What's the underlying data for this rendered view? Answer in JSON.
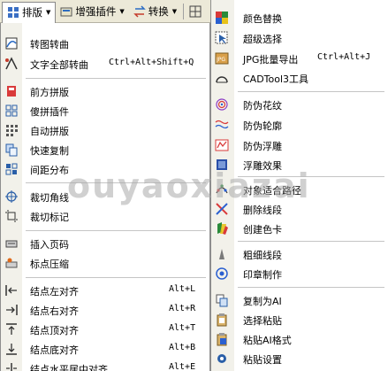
{
  "menubar": {
    "tabs": [
      {
        "label": "排版",
        "icon": "layout-icon"
      },
      {
        "label": "增强插件",
        "icon": "plugin-icon"
      },
      {
        "label": "转换",
        "icon": "convert-icon"
      }
    ]
  },
  "left_menu": {
    "items": [
      {
        "label": "转图转曲",
        "shortcut": ""
      },
      {
        "label": "文字全部转曲",
        "shortcut": "Ctrl+Alt+Shift+Q"
      },
      {
        "label": "前方拼版",
        "shortcut": ""
      },
      {
        "label": "傻拼插件",
        "shortcut": ""
      },
      {
        "label": "自动拼版",
        "shortcut": ""
      },
      {
        "label": "快速复制",
        "shortcut": ""
      },
      {
        "label": "间距分布",
        "shortcut": ""
      },
      {
        "label": "裁切角线",
        "shortcut": ""
      },
      {
        "label": "裁切标记",
        "shortcut": ""
      },
      {
        "label": "插入页码",
        "shortcut": ""
      },
      {
        "label": "标点压缩",
        "shortcut": ""
      },
      {
        "label": "结点左对齐",
        "shortcut": "Alt+L"
      },
      {
        "label": "结点右对齐",
        "shortcut": "Alt+R"
      },
      {
        "label": "结点顶对齐",
        "shortcut": "Alt+T"
      },
      {
        "label": "结点底对齐",
        "shortcut": "Alt+B"
      },
      {
        "label": "结点水平居中对齐",
        "shortcut": "Alt+E"
      }
    ]
  },
  "right_menu": {
    "items": [
      {
        "label": "颜色替换",
        "shortcut": ""
      },
      {
        "label": "超级选择",
        "shortcut": ""
      },
      {
        "label": "JPG批量导出",
        "shortcut": "Ctrl+Alt+J"
      },
      {
        "label": "CADTool3工具",
        "shortcut": ""
      },
      {
        "label": "防伪花纹",
        "shortcut": ""
      },
      {
        "label": "防伪轮廓",
        "shortcut": ""
      },
      {
        "label": "防伪浮雕",
        "shortcut": ""
      },
      {
        "label": "浮雕效果",
        "shortcut": ""
      },
      {
        "label": "对象适合路径",
        "shortcut": ""
      },
      {
        "label": "删除线段",
        "shortcut": ""
      },
      {
        "label": "创建色卡",
        "shortcut": ""
      },
      {
        "label": "粗细线段",
        "shortcut": ""
      },
      {
        "label": "印章制作",
        "shortcut": ""
      },
      {
        "label": "复制为AI",
        "shortcut": ""
      },
      {
        "label": "选择粘贴",
        "shortcut": ""
      },
      {
        "label": "粘贴AI格式",
        "shortcut": ""
      },
      {
        "label": "粘贴设置",
        "shortcut": ""
      }
    ]
  },
  "watermark": "ouyaoxiazai",
  "colors": {
    "gutter": "#f2f1ea",
    "menubar": "#ece9d8",
    "divider": "#c5c5c5"
  }
}
